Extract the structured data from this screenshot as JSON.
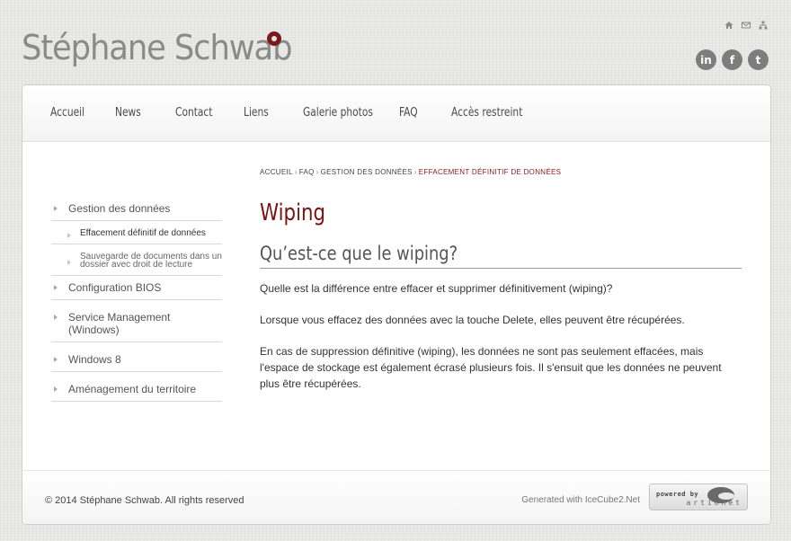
{
  "site": {
    "title": "Stéphane Schwab"
  },
  "utility_icons": [
    "home-icon",
    "mail-icon",
    "sitemap-icon"
  ],
  "social": [
    {
      "name": "linkedin-icon",
      "glyph": "in"
    },
    {
      "name": "facebook-icon",
      "glyph": "f"
    },
    {
      "name": "tumblr-icon",
      "glyph": "t"
    }
  ],
  "nav": {
    "items": [
      "Accueil",
      "News",
      "Contact",
      "Liens",
      "Galerie photos",
      "FAQ",
      "Accès restreint"
    ]
  },
  "breadcrumb": {
    "items": [
      "ACCUEIL",
      "FAQ",
      "GESTION DES DONNÉES"
    ],
    "separator": "›",
    "current": "EFFACEMENT DÉFINITIF DE DONNÉES"
  },
  "sidebar": {
    "items": [
      {
        "label": "Gestion des données"
      },
      {
        "label": "Effacement définitif de données"
      },
      {
        "label": "Sauvegarde de documents dans un dossier avec droit de lecture"
      },
      {
        "label": "Configuration BIOS"
      },
      {
        "label": "Service Management (Windows)"
      },
      {
        "label": "Windows 8"
      },
      {
        "label": "Aménagement du territoire"
      }
    ]
  },
  "content": {
    "title": "Wiping",
    "subtitle": "Qu’est-ce que le wiping?",
    "paragraphs": [
      "Quelle est la différence entre effacer et supprimer définitivement (wiping)?",
      "Lorsque vous effacez des données avec la touche Delete, elles peuvent être récupérées.",
      "En cas de suppression définitive (wiping), les données ne sont pas seulement effacées, mais l'espace de stockage est également écrasé plusieurs fois. Il s'ensuit que les données ne peuvent plus être récupérées."
    ]
  },
  "footer": {
    "copyright": "© 2014 Stéphane Schwab. All rights reserved",
    "generated": "Generated with IceCube2.Net",
    "badge_line1": "powered by",
    "badge_line2": "artionet"
  },
  "colors": {
    "accent": "#7a1212",
    "text": "#333333",
    "muted": "#8a8a8a"
  }
}
